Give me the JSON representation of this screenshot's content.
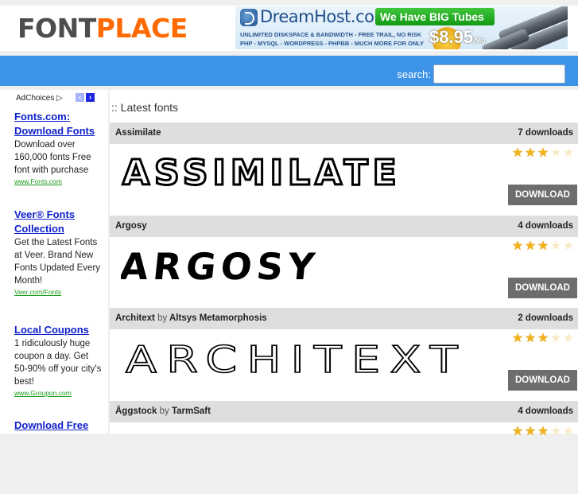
{
  "header": {
    "logo_part1": "FONT",
    "logo_part2": "PLACE",
    "banner": {
      "brand": "DreamHost.com",
      "headline": "We Have BIG Tubes",
      "line1": "UNLIMITED DISKSPACE & BANDWIDTH - FREE TRAIL, NO RISK",
      "line2": "PHP - MYSQL - WORDPRESS - PHPBB - MUCH MORE FOR ONLY",
      "price": "$8.95",
      "price_suffix": "/Mo"
    }
  },
  "nav": {
    "search_label": "search:",
    "search_value": ""
  },
  "sidebar": {
    "adchoices_label": "AdChoices",
    "prev_icon": "‹",
    "next_icon": "›",
    "ads": [
      {
        "title": "Fonts.com: Download Fonts",
        "body": "Download over 160,000 fonts Free font with purchase",
        "url": "www.Fonts.com"
      },
      {
        "title": "Veer® Fonts Collection",
        "body": "Get the Latest Fonts at Veer. Brand New Fonts Updated Every Month!",
        "url": "Veer.com/Fonts"
      },
      {
        "title": "Local Coupons",
        "body": "1 ridiculously huge coupon a day. Get 50-90% off your city's best!",
        "url": "www.Groupon.com"
      },
      {
        "title": "Download Free",
        "body": "",
        "url": ""
      }
    ]
  },
  "main": {
    "section_title": ":: Latest fonts",
    "by_label": "by",
    "download_label": "DOWNLOAD",
    "fonts": [
      {
        "name": "Assimilate",
        "author": "",
        "downloads": "7 downloads",
        "rating": 3,
        "max_rating": 5,
        "preview_text": "ASSIMILATE"
      },
      {
        "name": "Argosy",
        "author": "",
        "downloads": "4 downloads",
        "rating": 3,
        "max_rating": 5,
        "preview_text": "ARGOSY"
      },
      {
        "name": "Architext",
        "author": "Altsys Metamorphosis",
        "downloads": "2 downloads",
        "rating": 3,
        "max_rating": 5,
        "preview_text": "ARCHITEXT"
      },
      {
        "name": "Äggstock",
        "author": "TarmSaft",
        "downloads": "4 downloads",
        "rating": 3,
        "max_rating": 5,
        "preview_text": ""
      }
    ]
  }
}
